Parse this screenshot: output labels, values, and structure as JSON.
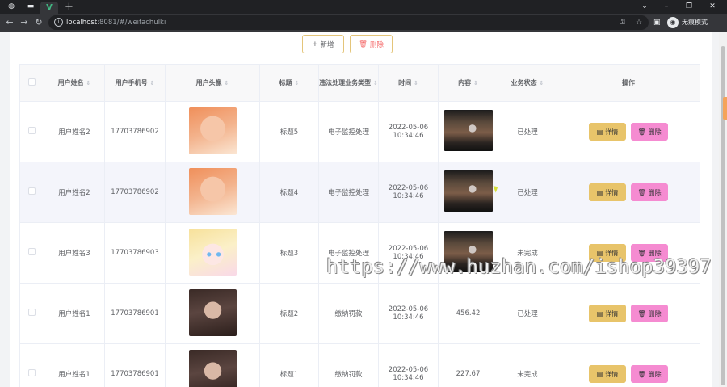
{
  "browser": {
    "url_host": "localhost",
    "url_rest": ":8081/#/weifachulki",
    "incognito_label": "无痕模式"
  },
  "actions": {
    "add_label": "新增",
    "delete_label": "删除"
  },
  "table": {
    "headers": [
      "用户姓名",
      "用户手机号",
      "用户头像",
      "标题",
      "违法处理业务类型",
      "时间",
      "内容",
      "业务状态",
      "操作"
    ],
    "rows": [
      {
        "name": "用户姓名2",
        "phone": "17703786902",
        "avatar": "girl-warm",
        "title": "标题5",
        "type": "电子监控处理",
        "time": "2022-05-06 10:34:46",
        "content_kind": "video",
        "content": "",
        "status": "已处理"
      },
      {
        "name": "用户姓名2",
        "phone": "17703786902",
        "avatar": "girl-warm",
        "title": "标题4",
        "type": "电子监控处理",
        "time": "2022-05-06 10:34:46",
        "content_kind": "video",
        "content": "",
        "status": "已处理"
      },
      {
        "name": "用户姓名3",
        "phone": "17703786903",
        "avatar": "anime",
        "title": "标题3",
        "type": "电子监控处理",
        "time": "2022-05-06 10:34:46",
        "content_kind": "video",
        "content": "",
        "status": "未完成"
      },
      {
        "name": "用户姓名1",
        "phone": "17703786901",
        "avatar": "dark",
        "title": "标题2",
        "type": "缴纳罚款",
        "time": "2022-05-06 10:34:46",
        "content_kind": "text",
        "content": "456.42",
        "status": "已处理"
      },
      {
        "name": "用户姓名1",
        "phone": "17703786901",
        "avatar": "dark",
        "title": "标题1",
        "type": "缴纳罚款",
        "time": "2022-05-06 10:34:46",
        "content_kind": "text",
        "content": "227.67",
        "status": "未完成"
      }
    ],
    "row_actions": {
      "detail_label": "详情",
      "delete_label": "删除"
    }
  },
  "watermark": "https://www.huzhan.com/ishop39397"
}
